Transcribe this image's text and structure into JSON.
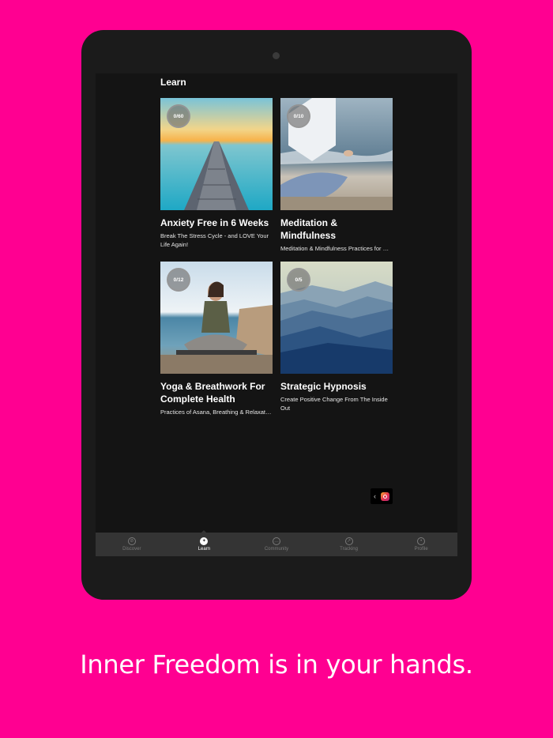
{
  "screen": {
    "title": "Learn",
    "courses": [
      {
        "progress": "0/60",
        "title": "Anxiety Free in 6 Weeks",
        "subtitle": "Break The Stress Cycle - and LOVE Your Life Again!",
        "image": "pier-at-sunrise"
      },
      {
        "progress": "0/10",
        "title": "Meditation & Mindfulness",
        "subtitle": "Meditation & Mindfulness Practices for Health & Wellbeing",
        "image": "meditating-on-beach"
      },
      {
        "progress": "0/12",
        "title": "Yoga  & Breathwork For Complete Health",
        "subtitle": "Practices of Asana, Breathing & Relaxation",
        "image": "yoga-woman-by-sea"
      },
      {
        "progress": "0/5",
        "title": "Strategic Hypnosis",
        "subtitle": "Create Positive Change From The Inside Out",
        "image": "blue-mountain-ridges"
      }
    ]
  },
  "tabbar": {
    "items": [
      {
        "label": "Discover",
        "icon": "compass-icon"
      },
      {
        "label": "Learn",
        "icon": "learn-icon"
      },
      {
        "label": "Community",
        "icon": "chat-icon"
      },
      {
        "label": "Tracking",
        "icon": "chart-icon"
      },
      {
        "label": "Profile",
        "icon": "profile-icon"
      }
    ],
    "active": "Learn"
  },
  "tagline": "Inner Freedom is in your hands.",
  "colors": {
    "background": "#ff0091",
    "device": "#1b1b1b",
    "screen": "#141414",
    "tabbar": "#343434"
  }
}
